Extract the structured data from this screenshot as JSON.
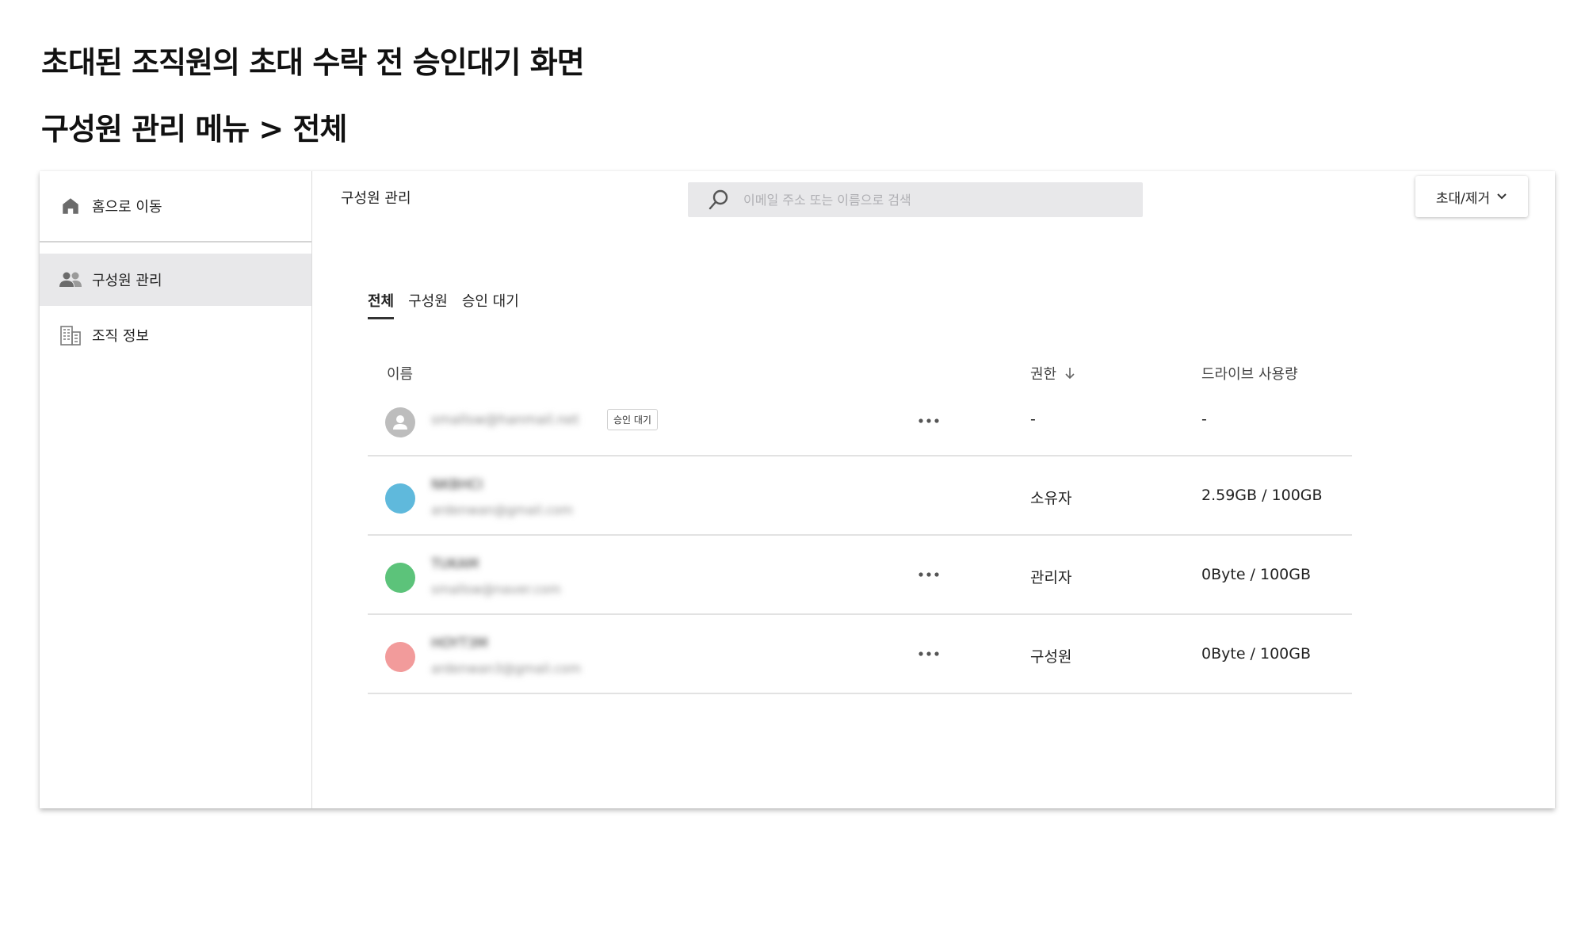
{
  "headings": {
    "title": "초대된 조직원의 초대 수락 전 승인대기 화면",
    "subtitle": "구성원 관리 메뉴 > 전체"
  },
  "sidebar": {
    "home_label": "홈으로 이동",
    "items": [
      {
        "label": "구성원 관리",
        "icon": "people-icon",
        "active": true
      },
      {
        "label": "조직 정보",
        "icon": "building-icon",
        "active": false
      }
    ]
  },
  "header": {
    "title": "구성원 관리",
    "search_placeholder": "이메일 주소 또는 이름으로 검색",
    "invite_label": "초대/제거"
  },
  "tabs": [
    {
      "label": "전체",
      "active": true
    },
    {
      "label": "구성원",
      "active": false
    },
    {
      "label": "승인 대기",
      "active": false
    }
  ],
  "table": {
    "columns": {
      "name": "이름",
      "role": "권한",
      "usage": "드라이브 사용량"
    },
    "rows": [
      {
        "name": "",
        "email": "smallsw@hanmail.net",
        "badge": "승인 대기",
        "role": "-",
        "usage": "-",
        "more": true,
        "avatar_color": "#bfbfbf"
      },
      {
        "name": "NKBHCI",
        "email": "ardenwan@gmail.com",
        "badge": "",
        "role": "소유자",
        "usage": "2.59GB / 100GB",
        "more": false,
        "avatar_color": "#5fb9dc"
      },
      {
        "name": "TUKAM",
        "email": "smallsw@naver.com",
        "badge": "",
        "role": "관리자",
        "usage": "0Byte / 100GB",
        "more": true,
        "avatar_color": "#5cc37a"
      },
      {
        "name": "HOYT3M",
        "email": "ardenwan3@gmail.com",
        "badge": "",
        "role": "구성원",
        "usage": "0Byte / 100GB",
        "more": true,
        "avatar_color": "#f29b9b"
      }
    ]
  },
  "colors": {
    "accent": "#333333",
    "active_bg": "#e8e8ea",
    "search_bg": "#e8e8ea"
  }
}
